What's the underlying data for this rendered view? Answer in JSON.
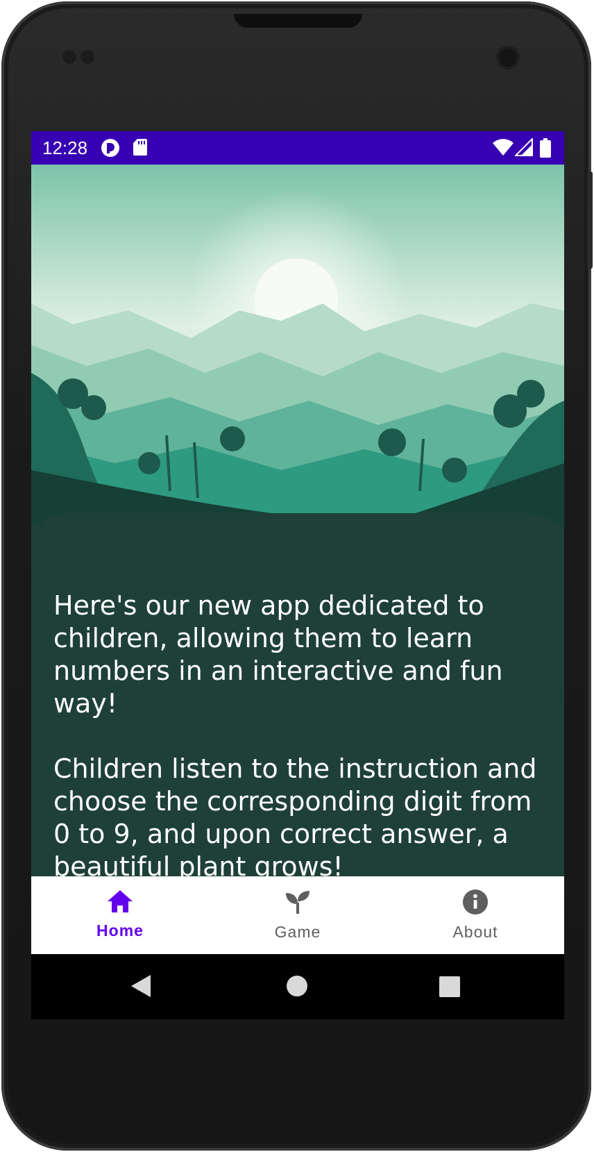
{
  "status_bar": {
    "time": "12:28",
    "left_icons": [
      "notification-app-icon",
      "sd-card-icon"
    ],
    "right_icons": [
      "wifi-icon",
      "cellular-signal-icon",
      "battery-icon"
    ],
    "background_color": "#3700b3"
  },
  "hero": {
    "image": "jungle-mountain-sunrise-illustration"
  },
  "content": {
    "paragraph": "Here's our new app dedicated to\nchildren, allowing them to learn\nnumbers in an interactive and fun way!\n\nChildren listen to the instruction and\nchoose the corresponding digit from\n0 to 9, and upon correct answer, a\nbeautiful plant grows!",
    "background_color": "#1e4038"
  },
  "bottom_nav": {
    "items": [
      {
        "label": "Home",
        "icon": "home-icon",
        "active": true
      },
      {
        "label": "Game",
        "icon": "sprout-icon",
        "active": false
      },
      {
        "label": "About",
        "icon": "info-icon",
        "active": false
      }
    ],
    "active_color": "#6200ee",
    "inactive_color": "#5f5f5f"
  },
  "system_nav": {
    "buttons": [
      "back-icon",
      "home-circle-icon",
      "recents-icon"
    ]
  }
}
